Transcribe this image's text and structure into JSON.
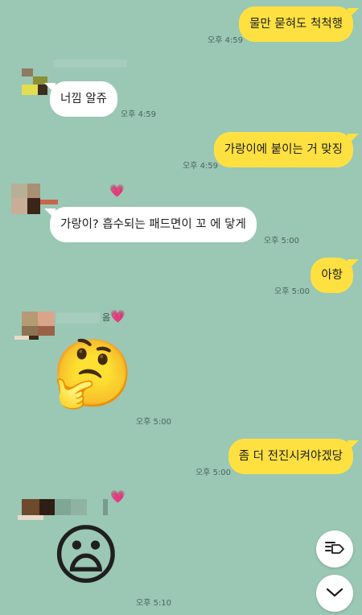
{
  "messages": [
    {
      "id": "m1",
      "text": "물만 묻혀도 척척행",
      "time": "오후 4:59"
    },
    {
      "id": "m2",
      "text": "너낌 알쥬",
      "time": "오후 4:59"
    },
    {
      "id": "m3",
      "text": "가랑이에 붙이는 거 맞징",
      "time": "오후 4:59"
    },
    {
      "id": "m4",
      "text": "가랑이? 흡수되는 패드면이 꼬   에 닿게",
      "time": "오후 5:00"
    },
    {
      "id": "m5",
      "text": "아항",
      "time": "오후 5:00"
    },
    {
      "id": "m6",
      "emoji": "🤔",
      "time": "오후 5:00"
    },
    {
      "id": "m7",
      "text": "좀 더 전진시켜야겠당",
      "time": "오후 5:00"
    },
    {
      "id": "m8",
      "emoji": "😦",
      "time": "오후 5:10"
    }
  ],
  "name_fragment": "옴",
  "heart": "💗",
  "icons": {
    "heart": "heart-icon",
    "shortcut": "list-tag-icon",
    "scroll_down": "chevron-down-icon"
  },
  "colors": {
    "background": "#9bc7b5",
    "my_bubble": "#fee140",
    "other_bubble": "#ffffff",
    "time_text": "#49655b"
  }
}
